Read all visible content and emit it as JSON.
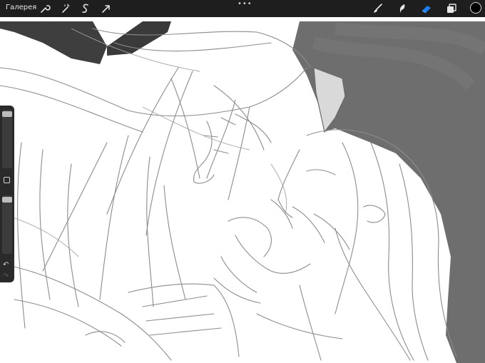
{
  "toolbar": {
    "gallery_label": "Галерея",
    "more_label": "•••",
    "left_icons": [
      "wrench-icon",
      "magic-wand-icon",
      "selection-s-icon",
      "arrow-transform-icon"
    ],
    "right_icons": [
      "brush-icon",
      "smudge-icon",
      "eraser-icon",
      "layers-icon"
    ],
    "active_tool": "eraser",
    "accent_color": "#1e7cf2",
    "current_color": "#000000"
  },
  "sidebar": {
    "brush_size_fraction": 0.1,
    "opacity_fraction": 0.05,
    "undo_icon": "undo-arrow-icon",
    "redo_icon": "redo-arrow-icon"
  },
  "canvas": {
    "background_fill": "#6e6e6e",
    "sketch_stroke": "#8a8a8a"
  }
}
